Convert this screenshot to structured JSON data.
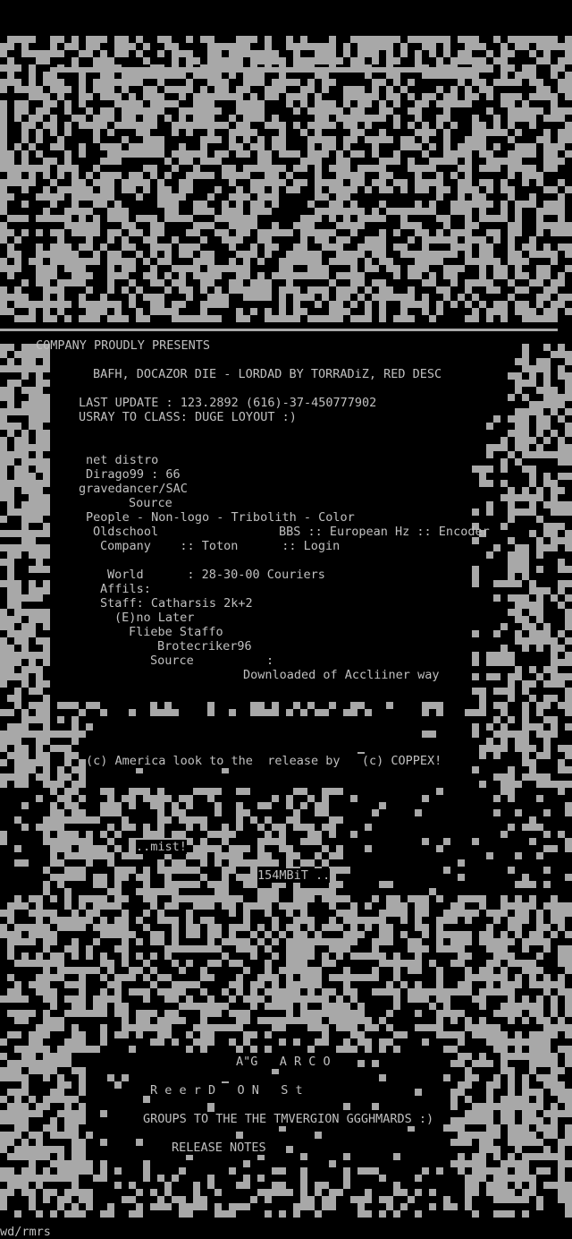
{
  "colors": {
    "background": "#000000",
    "ansi_gray": "#a8a8a8",
    "text": "#c0c0c0"
  },
  "header": {
    "presents": "COMPANY PROUDLY PRESENTS"
  },
  "release": {
    "title": "BAFH, DOCAZOR DIE - LORDAD BY TORRADiZ, RED DESC",
    "last_update": "LAST UPDATE : 123.2892 (616)-37-450777902",
    "usray": "USRAY TO CLASS: DUGE LOYOUT :)"
  },
  "info": {
    "net_distro": "net distro",
    "dirago": "Dirago99 : 66",
    "gravedancer": "gravedancer/SAC",
    "source": "Source",
    "people": "People - Non-logo - Tribolith - Color",
    "oldschool": "Oldschool",
    "bbs": "BBS :: European Hz :: Encoder",
    "company": "Company    :: Toton      :: Login",
    "world": "World      : 28-30-00 Couriers",
    "affils": "Affils:",
    "staff": "Staff: Catharsis 2k+2",
    "eno_later": "(E)no Later",
    "fliebe": "Fliebe Staffo",
    "brotecriker": "Brotecriker96",
    "source2": "Source          :",
    "downloaded": "Downloaded of Accliiner way"
  },
  "copyright": "(c) America look to the  release by   (c) COPPEX!",
  "mist": "..mist!",
  "speed": "154MBiT ..",
  "footer": {
    "agarco": "A\"G   A R C O",
    "reerd": "R e e r D   O N   S t",
    "groups": "GROUPS TO THE THE TMVERGION GGGHMARDS :)",
    "release_notes": "RELEASE NOTES"
  },
  "signature": "wd/rmrs"
}
